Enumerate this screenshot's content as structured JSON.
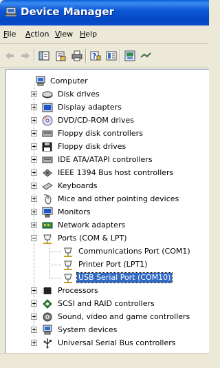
{
  "window": {
    "title": "Device Manager"
  },
  "menu": [
    {
      "label": "File",
      "u": "F",
      "rest": "ile"
    },
    {
      "label": "Action",
      "u": "A",
      "rest": "ction"
    },
    {
      "label": "View",
      "u": "V",
      "rest": "iew"
    },
    {
      "label": "Help",
      "u": "H",
      "rest": "elp"
    }
  ],
  "toolbar": [
    "back-icon",
    "forward-icon",
    "show-hide-console-tree-icon",
    "properties-icon",
    "print-icon",
    "help-icon",
    "details-view-icon",
    "scan-hardware-icon",
    "update-driver-icon"
  ],
  "tree": {
    "root_label": "Computer",
    "categories": [
      {
        "label": "Disk drives",
        "icon": "disk-drive-icon",
        "expanded": false
      },
      {
        "label": "Display adapters",
        "icon": "display-adapter-icon",
        "expanded": false
      },
      {
        "label": "DVD/CD-ROM drives",
        "icon": "dvd-cd-rom-icon",
        "expanded": false
      },
      {
        "label": "Floppy disk controllers",
        "icon": "floppy-controller-icon",
        "expanded": false
      },
      {
        "label": "Floppy disk drives",
        "icon": "floppy-drive-icon",
        "expanded": false
      },
      {
        "label": "IDE ATA/ATAPI controllers",
        "icon": "ide-controller-icon",
        "expanded": false
      },
      {
        "label": "IEEE 1394 Bus host controllers",
        "icon": "ieee1394-icon",
        "expanded": false
      },
      {
        "label": "Keyboards",
        "icon": "keyboard-icon",
        "expanded": false
      },
      {
        "label": "Mice and other pointing devices",
        "icon": "mouse-icon",
        "expanded": false
      },
      {
        "label": "Monitors",
        "icon": "monitor-icon",
        "expanded": false
      },
      {
        "label": "Network adapters",
        "icon": "network-adapter-icon",
        "expanded": false
      },
      {
        "label": "Ports (COM & LPT)",
        "icon": "port-icon",
        "expanded": true,
        "children": [
          {
            "label": "Communications Port (COM1)",
            "icon": "port-icon",
            "selected": false
          },
          {
            "label": "Printer Port (LPT1)",
            "icon": "port-icon",
            "selected": false
          },
          {
            "label": "USB Serial Port (COM10)",
            "icon": "port-icon",
            "selected": true
          }
        ]
      },
      {
        "label": "Processors",
        "icon": "processor-icon",
        "expanded": false
      },
      {
        "label": "SCSI and RAID controllers",
        "icon": "scsi-controller-icon",
        "expanded": false
      },
      {
        "label": "Sound, video and game controllers",
        "icon": "sound-icon",
        "expanded": false
      },
      {
        "label": "System devices",
        "icon": "system-device-icon",
        "expanded": false
      },
      {
        "label": "Universal Serial Bus controllers",
        "icon": "usb-icon",
        "expanded": false
      }
    ]
  },
  "colors": {
    "titlebar": "#0b58d6",
    "selection": "#316ac5",
    "tree_border": "#7f9db9"
  }
}
